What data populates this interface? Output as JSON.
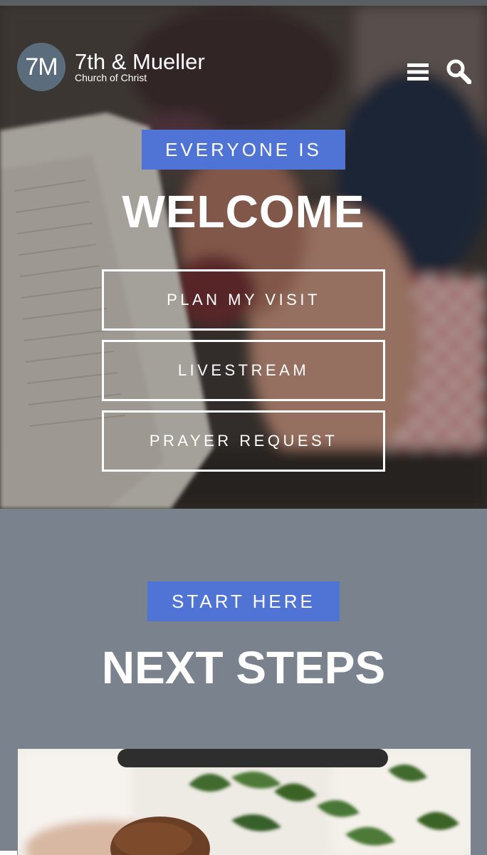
{
  "header": {
    "logo_mark": "7M",
    "logo_name": "7th & Mueller",
    "logo_sub": "Church of Christ"
  },
  "hero": {
    "tag": "EVERYONE IS",
    "title": "WELCOME",
    "buttons": [
      {
        "label": "PLAN MY VISIT"
      },
      {
        "label": "LIVESTREAM"
      },
      {
        "label": "PRAYER REQUEST"
      }
    ]
  },
  "next_steps": {
    "tag": "START HERE",
    "title": "NEXT STEPS"
  },
  "colors": {
    "accent_blue": "#4f74d6",
    "section_gray": "#7a838d",
    "logo_circle": "#5b6d7c"
  },
  "icons": [
    "menu-icon",
    "search-icon"
  ]
}
